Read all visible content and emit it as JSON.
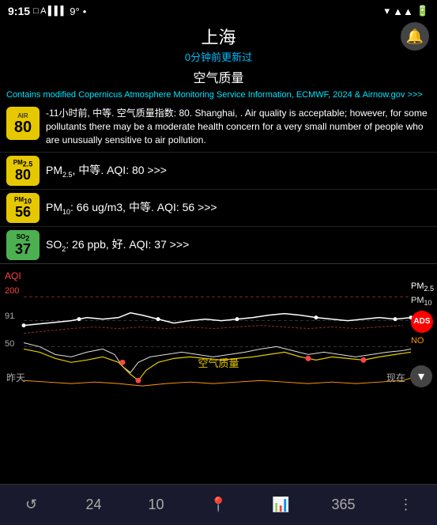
{
  "statusBar": {
    "time": "9:15",
    "signal": "●●●●",
    "battery": "9°"
  },
  "header": {
    "city": "上海",
    "updateTime": "0分钟前更新过"
  },
  "aqTitle": "空气质量",
  "attribution": "Contains modified Copernicus Atmosphere Monitoring Service Information, ECMWF, 2024 & Airnow.gov >>>",
  "mainAqi": {
    "badgeLabel": "AIR",
    "badgeNum": "80",
    "description": "-11小时前, 中等. 空气质量指数: 80. Shanghai,  . Air quality is acceptable; however, for some pollutants there may be a moderate health concern for a very small number of people who are unusually sensitive to air pollution."
  },
  "pollutants": [
    {
      "badgeLabel": "PM₂.₅",
      "badgeNum": "80",
      "color": "#e6c800",
      "text": "PM₂.₅, 中等. AQI: 80 >>>"
    },
    {
      "badgeLabel": "PM₁₀",
      "badgeNum": "56",
      "color": "#e6c800",
      "text": "PM₁₀: 66 ug/m3, 中等. AQI: 56 >>>"
    },
    {
      "badgeLabel": "SO₂",
      "badgeNum": "37",
      "color": "#4caf50",
      "text": "SO₂: 26 ppb, 好. AQI: 37 >>>"
    }
  ],
  "chart": {
    "labelAqi": "AQI",
    "val200": "200",
    "val91": "91",
    "val50": "50",
    "labelAq": "空气质量",
    "timeYesterday": "昨天",
    "timeNow": "现在",
    "legend": {
      "pm25": "PM₂.₅",
      "pm10": "PM₁₀",
      "ads": "ADS",
      "no": "NO"
    }
  },
  "bottomNav": [
    {
      "id": "refresh",
      "icon": "↺",
      "label": ""
    },
    {
      "id": "24h",
      "icon": "",
      "label": "24"
    },
    {
      "id": "10d",
      "icon": "",
      "label": "10"
    },
    {
      "id": "location",
      "icon": "📍",
      "label": ""
    },
    {
      "id": "chart",
      "icon": "📊",
      "label": ""
    },
    {
      "id": "365",
      "icon": "",
      "label": "365"
    },
    {
      "id": "more",
      "icon": "⋮",
      "label": ""
    }
  ]
}
